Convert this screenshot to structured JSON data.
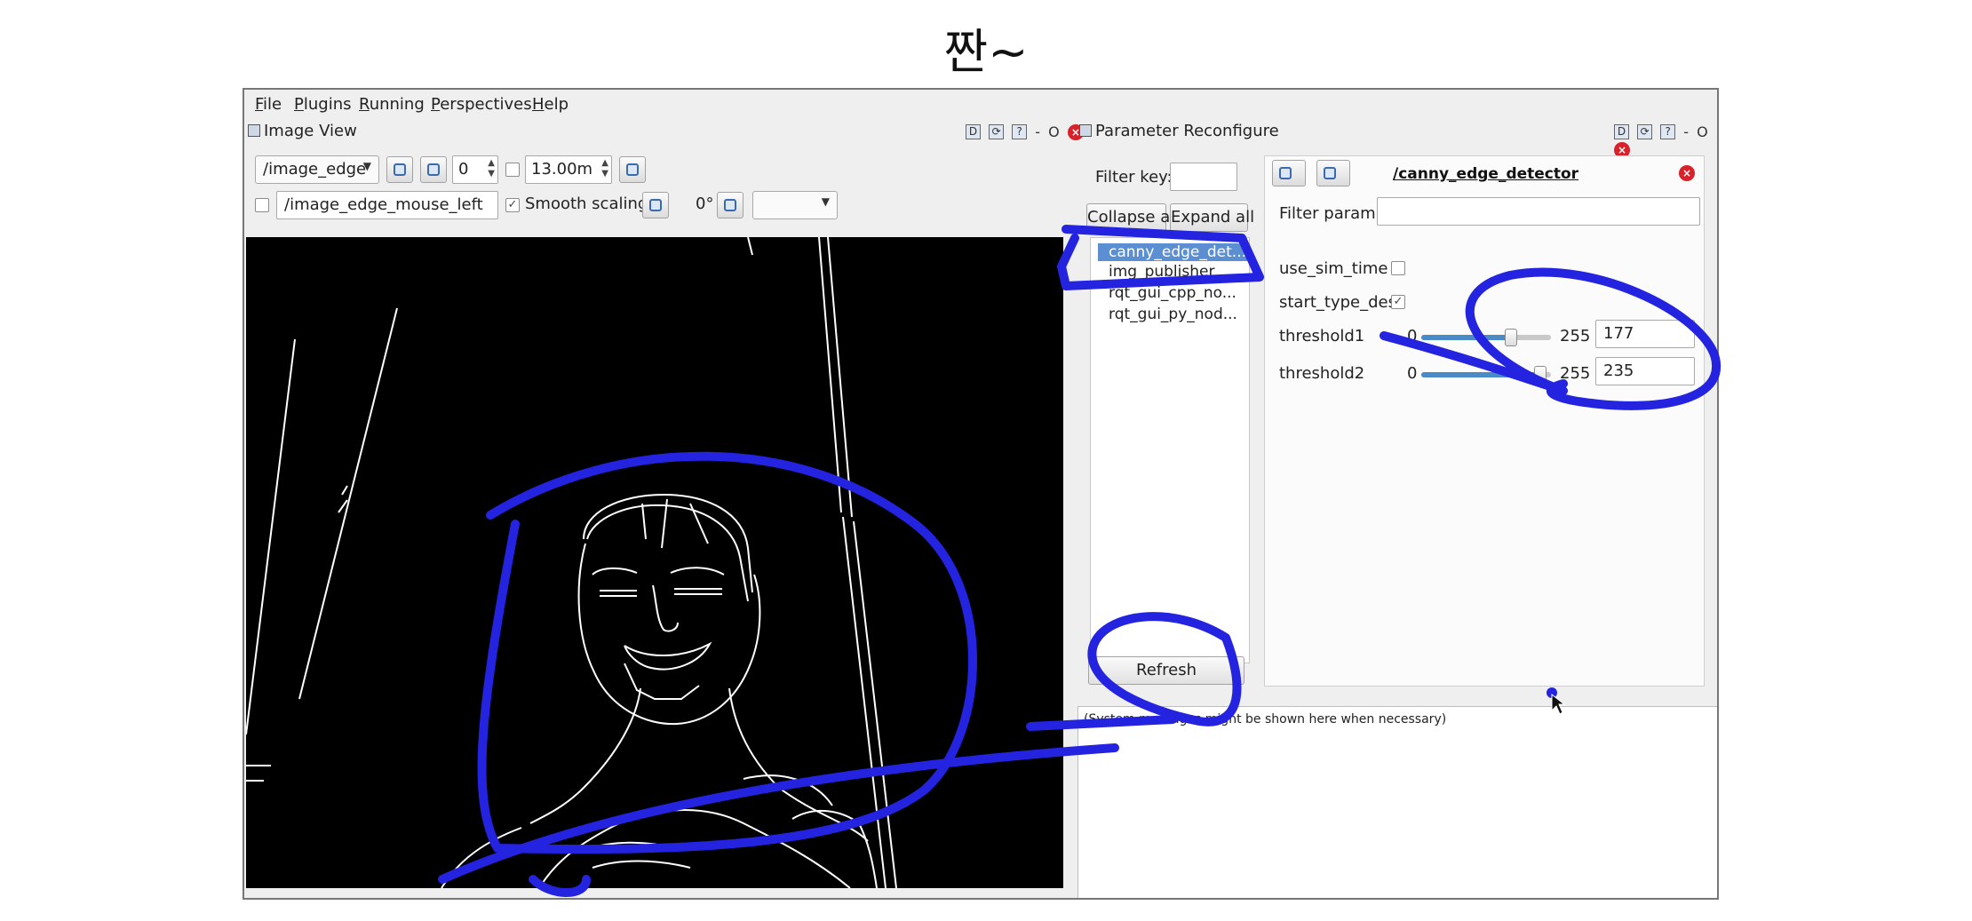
{
  "slide": {
    "title": "짠~"
  },
  "menu": [
    {
      "label": "File"
    },
    {
      "label": "Plugins"
    },
    {
      "label": "Running"
    },
    {
      "label": "Perspectives"
    },
    {
      "label": "Help"
    }
  ],
  "image_view": {
    "title": "Image View",
    "topic": "/image_edge",
    "zoom_value": "0",
    "duration": "13.00m",
    "mouse_topic": "/image_edge_mouse_left",
    "smooth_scaling_label": "Smooth scaling",
    "smooth_scaling_checked": true,
    "rotation": "0°"
  },
  "dock_controls": {
    "d": "D",
    "o": "O"
  },
  "param_reconfigure": {
    "title": "Parameter Reconfigure",
    "filter_key_label": "Filter key:",
    "collapse_all": "Collapse all",
    "expand_all": "Expand all",
    "nodes": [
      "canny_edge_det...",
      "img_publisher",
      "rqt_gui_cpp_no...",
      "rqt_gui_py_nod..."
    ],
    "selected_node_index": 0,
    "refresh": "Refresh",
    "node_title": "/canny_edge_detector",
    "filter_param_label": "Filter param:",
    "params": {
      "use_sim_time": {
        "label": "use_sim_time",
        "checked": false
      },
      "start_type_des": {
        "label": "start_type_des",
        "checked": true
      },
      "threshold1": {
        "label": "threshold1",
        "min": "0",
        "max": "255",
        "value": "177",
        "fraction": 0.694
      },
      "threshold2": {
        "label": "threshold2",
        "min": "0",
        "max": "255",
        "value": "235",
        "fraction": 0.92
      }
    }
  },
  "console": {
    "message": "(System messages might be shown here when necessary)"
  },
  "colors": {
    "annotation": "#2323e0",
    "selection": "#5c8fd2",
    "slider_fill": "#4a8bc7",
    "close": "#d8212a"
  }
}
